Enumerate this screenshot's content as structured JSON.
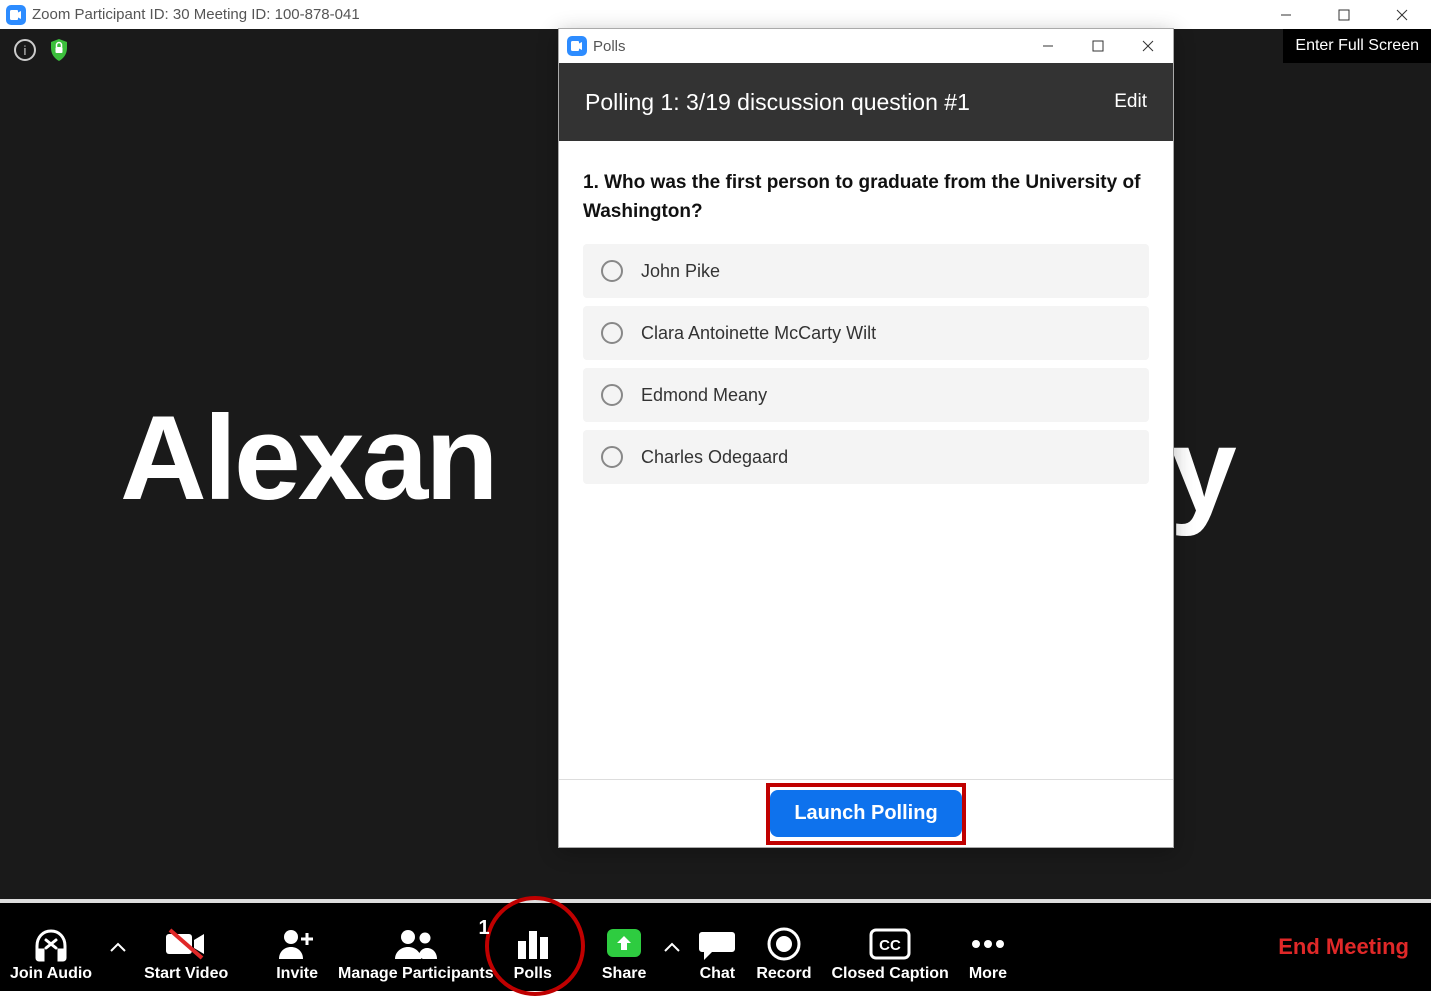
{
  "titlebar": {
    "text": "Zoom Participant ID: 30   Meeting ID: 100-878-041"
  },
  "stage": {
    "fullscreen_label": "Enter Full Screen",
    "participant_name_left": "Alexan",
    "participant_name_right_fragment": "y"
  },
  "toolbar": {
    "join_audio": "Join Audio",
    "start_video": "Start Video",
    "invite": "Invite",
    "manage_participants": "Manage Participants",
    "participant_count": "1",
    "polls": "Polls",
    "share": "Share",
    "chat": "Chat",
    "record": "Record",
    "closed_caption": "Closed Caption",
    "more": "More",
    "end_meeting": "End Meeting"
  },
  "polls_window": {
    "window_title": "Polls",
    "header_title": "Polling 1: 3/19 discussion question #1",
    "edit_label": "Edit",
    "question": "1. Who was the first person to graduate from the University of Washington?",
    "options": [
      "John Pike",
      "Clara Antoinette McCarty Wilt",
      "Edmond Meany",
      "Charles Odegaard"
    ],
    "launch_label": "Launch Polling"
  }
}
